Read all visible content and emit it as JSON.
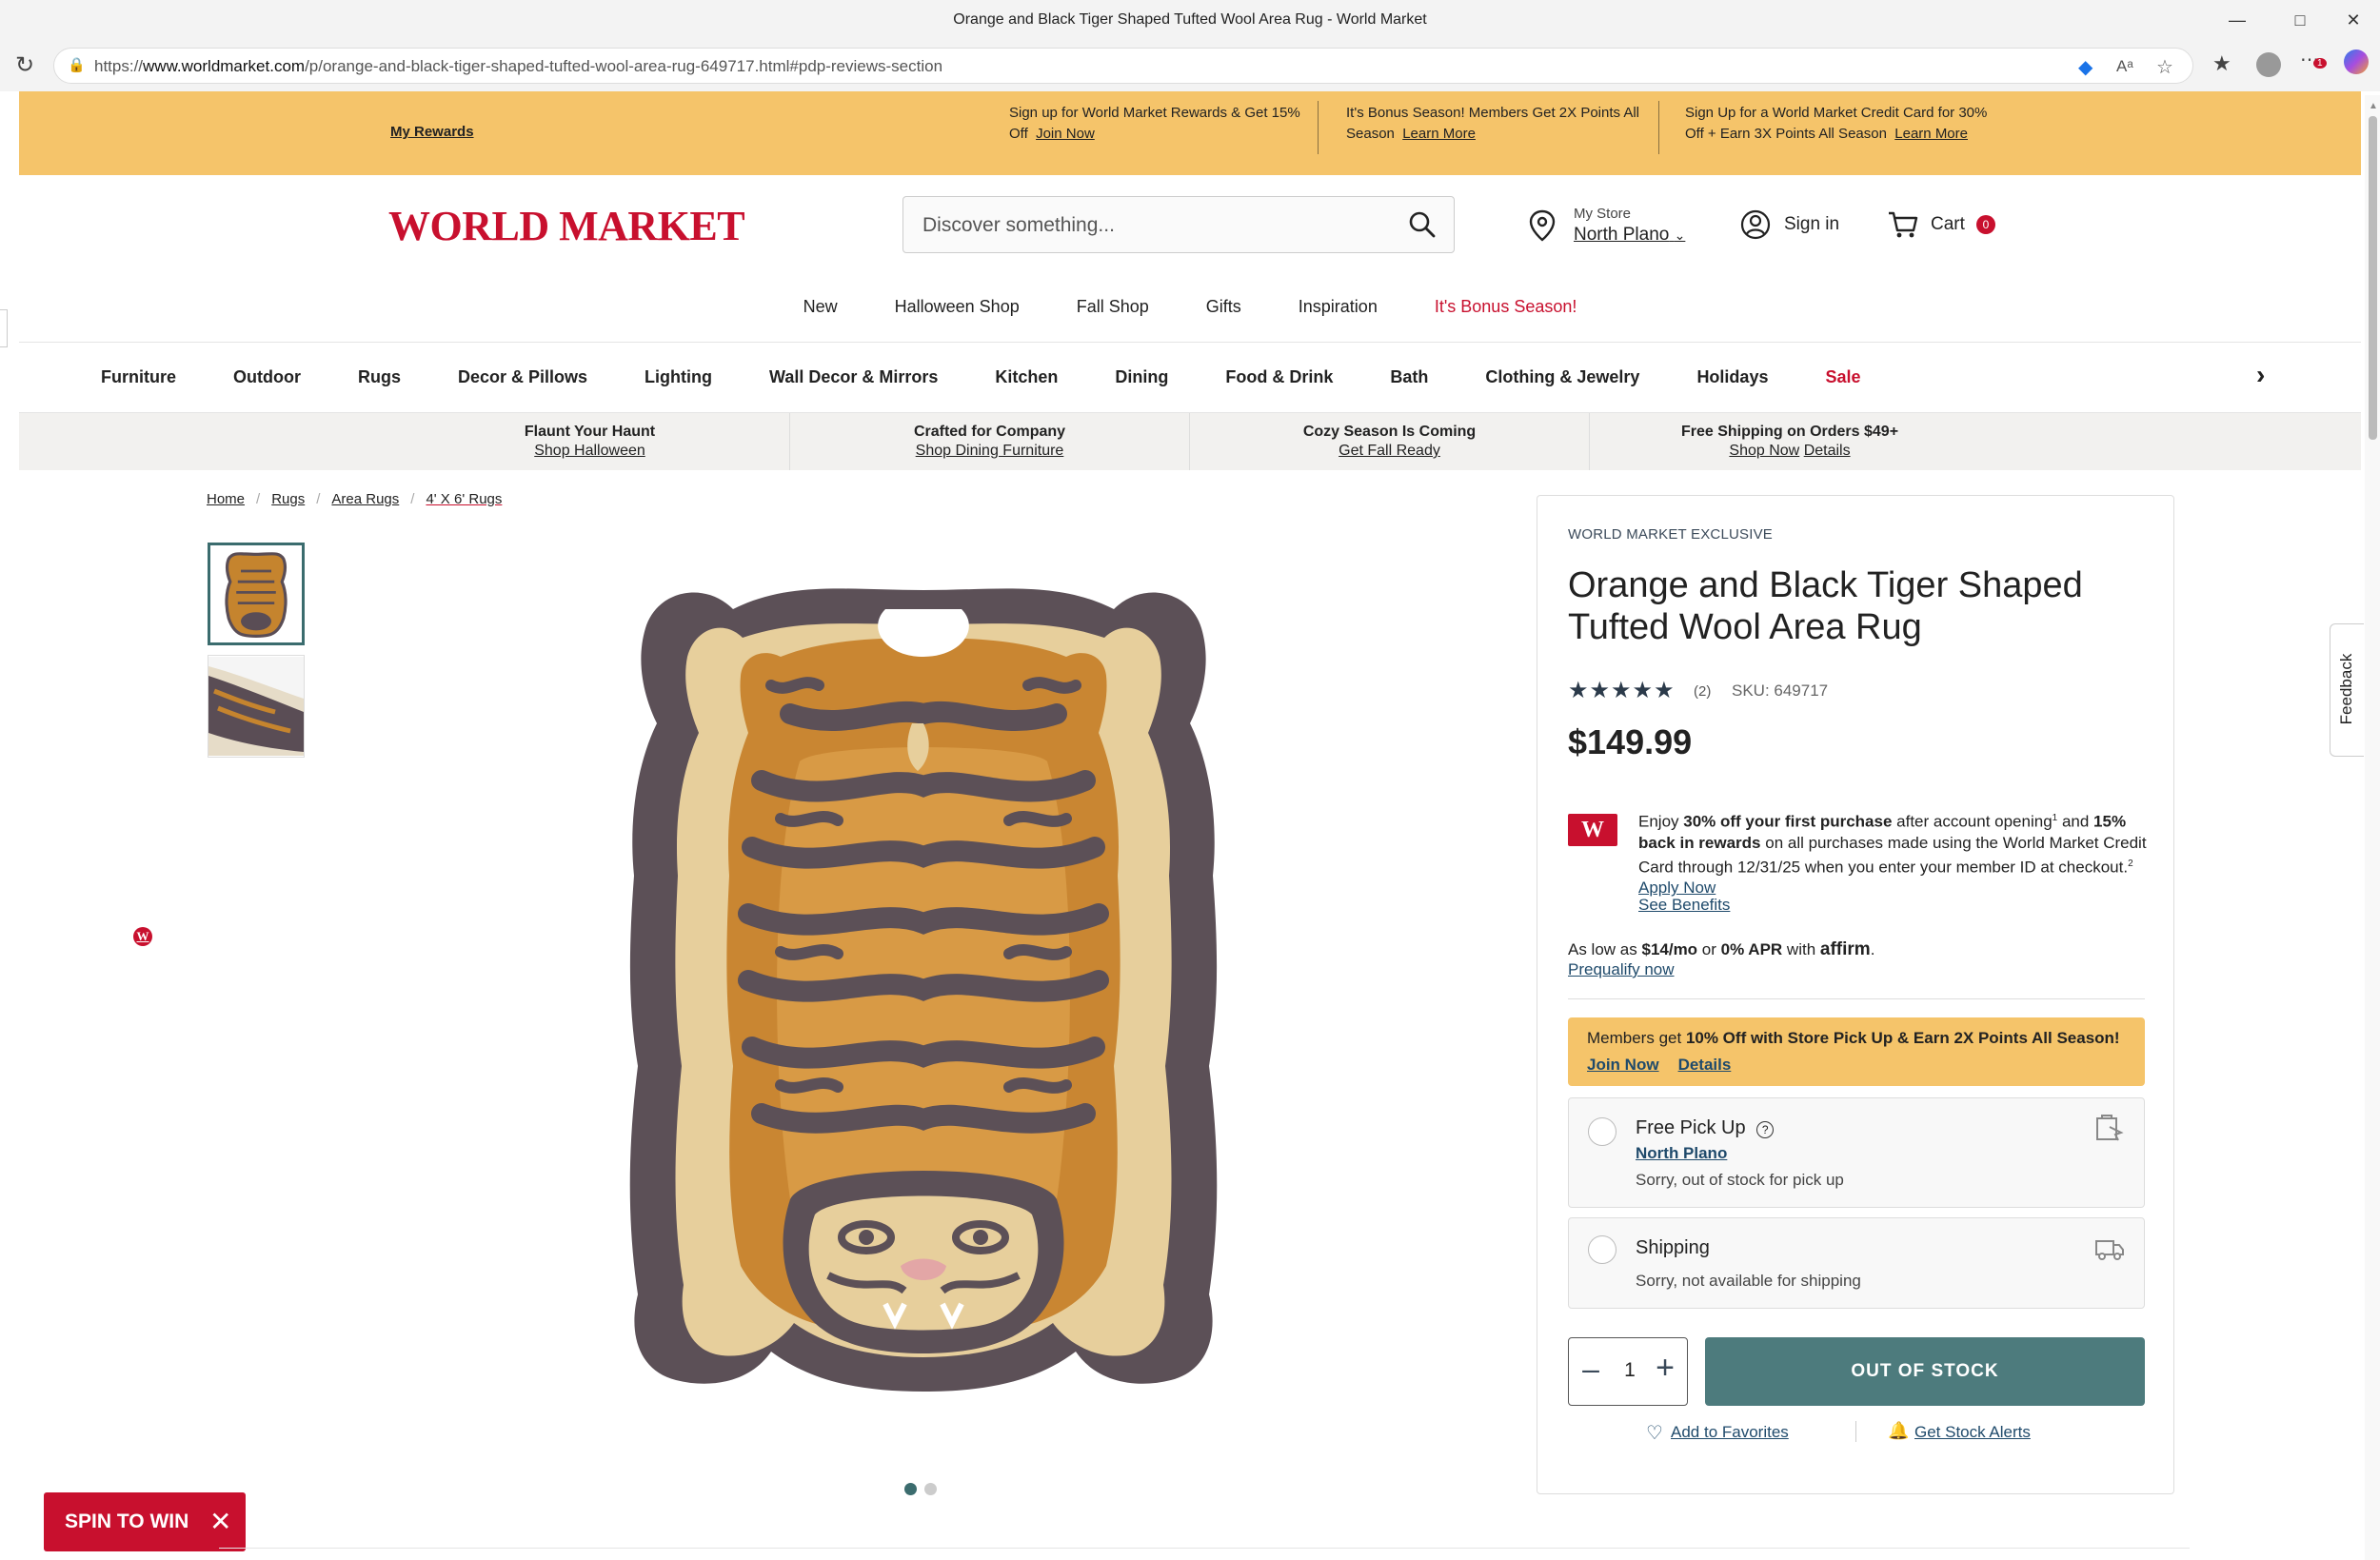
{
  "browser": {
    "window_title": "Orange and Black Tiger Shaped Tufted Wool Area Rug - World Market",
    "url_prefix": "https://",
    "url_host": "www.worldmarket.com",
    "url_path": "/p/orange-and-black-tiger-shaped-tufted-wool-area-rug-649717.html#pdp-reviews-section",
    "notification_count": "1"
  },
  "promo": {
    "rewards_link": "My Rewards",
    "msg1_text": "Sign up for World Market Rewards & Get 15% Off",
    "msg1_link": "Join Now",
    "msg2_text": "It's Bonus Season! Members Get 2X Points All Season",
    "msg2_link": "Learn More",
    "msg3_text": "Sign Up for a World Market Credit Card for 30% Off + Earn 3X Points All Season",
    "msg3_link": "Learn More"
  },
  "header": {
    "logo": "WORLD MARKET",
    "search_placeholder": "Discover something...",
    "store_label": "My Store",
    "store_value": "North Plano",
    "signin": "Sign in",
    "cart_label": "Cart",
    "cart_count": "0"
  },
  "subnav": [
    "New",
    "Halloween Shop",
    "Fall Shop",
    "Gifts",
    "Inspiration",
    "It's Bonus Season!"
  ],
  "categories": [
    "Furniture",
    "Outdoor",
    "Rugs",
    "Decor & Pillows",
    "Lighting",
    "Wall Decor & Mirrors",
    "Kitchen",
    "Dining",
    "Food & Drink",
    "Bath",
    "Clothing & Jewelry",
    "Holidays",
    "Sale"
  ],
  "benefits": [
    {
      "title": "Flaunt Your Haunt",
      "link": "Shop Halloween"
    },
    {
      "title": "Crafted for Company",
      "link": "Shop Dining Furniture"
    },
    {
      "title": "Cozy Season Is Coming",
      "link": "Get Fall Ready"
    },
    {
      "title": "Free Shipping on Orders $49+",
      "link": "Shop Now",
      "link2": "Details"
    }
  ],
  "breadcrumb": [
    "Home",
    "Rugs",
    "Area Rugs",
    "4' X 6' Rugs"
  ],
  "product": {
    "exclusive": "WORLD MARKET EXCLUSIVE",
    "title": "Orange and Black Tiger Shaped Tufted Wool Area Rug",
    "rating_stars": "★★★★★",
    "rating": 5,
    "review_count": "(2)",
    "sku": "SKU: 649717",
    "price": "$149.99",
    "credit_card_logo": "W",
    "cc_p1": "Enjoy ",
    "cc_b1": "30% off your first purchase",
    "cc_p2": " after account opening",
    "cc_sup1": "1",
    "cc_p3": " and ",
    "cc_b2": "15% back in rewards",
    "cc_p4": " on all purchases made using the World Market Credit Card through 12/31/25 when you enter your member ID at checkout.",
    "cc_sup2": "2",
    "cc_link": "Apply Now",
    "see_benefits": "See Benefits",
    "affirm_p1": "As low as ",
    "affirm_b1": "$14/mo",
    "affirm_p2": " or ",
    "affirm_b2": "0% APR",
    "affirm_p3": " with ",
    "affirm_brand": "affirm",
    "affirm_end": ".",
    "prequalify": "Prequalify now",
    "members_p1": "Members get ",
    "members_b1": "10% Off with Store Pick Up & Earn 2X Points All Season!",
    "members_join": "Join Now",
    "members_details": "Details",
    "pickup_title": "Free Pick Up",
    "pickup_store": "North Plano",
    "pickup_status": "Sorry, out of stock for pick up",
    "ship_title": "Shipping",
    "ship_status": "Sorry, not available for shipping",
    "qty": "1",
    "oos_button": "OUT OF STOCK",
    "add_fav": "Add to Favorites",
    "stock_alerts": "Get Stock Alerts"
  },
  "feedback": "Feedback",
  "spin": "SPIN TO WIN",
  "colors": {
    "brand_red": "#c8102e",
    "promo_yellow": "#f5c46a",
    "teal": "#4d7b7d",
    "link_blue": "#1f4a6b"
  }
}
